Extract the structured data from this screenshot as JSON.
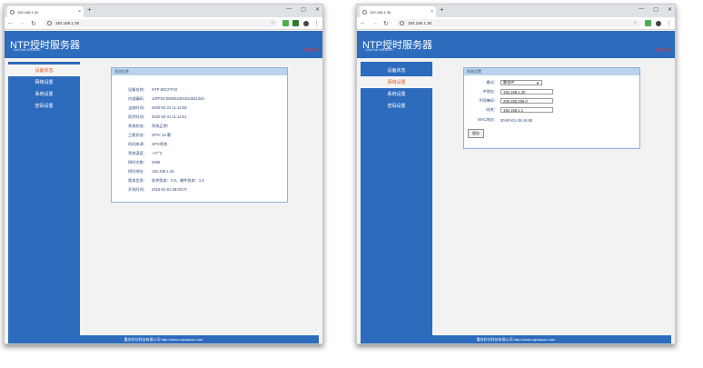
{
  "browser": {
    "tab_title": "192.168.1.30",
    "url": "192.168.1.30",
    "new_tab": "+",
    "tab_close": "×",
    "window_controls": [
      "—",
      "▢",
      "✕"
    ]
  },
  "app": {
    "title": "NTP授时服务器",
    "subtitle": "- MarClub MA-B02G -",
    "right_text": "设置欢迎您",
    "footer": "重庆秒谷科技有限公司 http://www.cqmiaoan.com"
  },
  "left_window": {
    "menu": [
      {
        "label": "设备状态",
        "active": true
      },
      {
        "label": "网络设置",
        "active": false
      },
      {
        "label": "系统设置",
        "active": false
      },
      {
        "label": "密码设置",
        "active": false
      }
    ],
    "panel_title": "状态信息",
    "rows": [
      {
        "k": "设备名称：",
        "v": "NTP-5DCFF33"
      },
      {
        "k": "内部编码：",
        "v": "10FFDC055052301534501343"
      },
      {
        "k": "当前时间：",
        "v": "2020-02-21 11:14:08"
      },
      {
        "k": "同步时间：",
        "v": "2020-02-21 11:14:01"
      },
      {
        "k": "系统状态：",
        "v": "系统正常！"
      },
      {
        "k": "卫星状态：",
        "v": "GPS: 34 颗"
      },
      {
        "k": "时间来源：",
        "v": "GPS系统"
      },
      {
        "k": "系统温度：",
        "v": "+17°C"
      },
      {
        "k": "授时次数：",
        "v": "2068"
      },
      {
        "k": "授时地址：",
        "v": "192.168.1.34"
      },
      {
        "k": "版本信息：",
        "v": "软件版本：2.9，硬件版本：1.8"
      },
      {
        "k": "开机时间：",
        "v": "2019-01-01 08:00:07"
      }
    ]
  },
  "right_window": {
    "menu": [
      {
        "label": "设备状态",
        "active": false
      },
      {
        "label": "网络设置",
        "active": true
      },
      {
        "label": "系统设置",
        "active": false
      },
      {
        "label": "密码设置",
        "active": false
      }
    ],
    "panel_title": "网络设置",
    "mode_label": "模式：",
    "mode_value": "静态IP",
    "ip_label": "IP地址：",
    "ip_value": "192.168.1.30",
    "mask_label": "子网掩码：",
    "mask_value": "255.255.255.0",
    "gateway_label": "网关：",
    "gateway_value": "192.168.1.1",
    "mac_label": "MAC地址：",
    "mac_value": "00-80-E1-35-34-50",
    "save_label": "保存"
  }
}
